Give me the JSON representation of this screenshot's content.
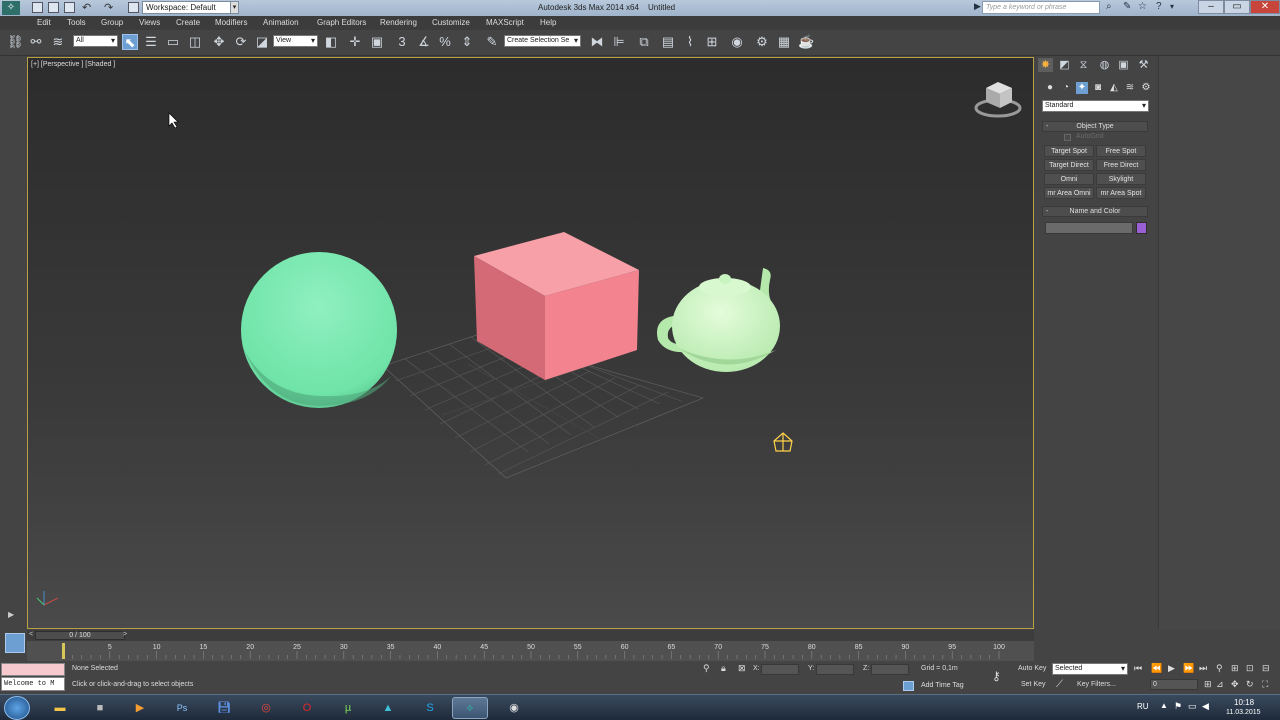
{
  "titlebar": {
    "workspace": "Workspace: Default",
    "app_title": "Autodesk 3ds Max 2014 x64",
    "doc_title": "Untitled",
    "search_placeholder": "Type a keyword or phrase"
  },
  "menu": [
    "Edit",
    "Tools",
    "Group",
    "Views",
    "Create",
    "Modifiers",
    "Animation",
    "Graph Editors",
    "Rendering",
    "Customize",
    "MAXScript",
    "Help"
  ],
  "toolbar": {
    "selection_filter": "All",
    "ref_coord": "View",
    "named_selection": "Create Selection Se"
  },
  "viewport": {
    "label": "[+] [Perspective ] [Shaded ]",
    "border_color": "#b7a143"
  },
  "command_panel": {
    "category_dropdown": "Standard",
    "object_type_header": "Object Type",
    "autogrid_label": "AutoGrid",
    "buttons": [
      "Target Spot",
      "Free Spot",
      "Target Direct",
      "Free Direct",
      "Omni",
      "Skylight",
      "mr Area Omni",
      "mr Area Spot"
    ],
    "name_color_header": "Name and Color",
    "swatch_color": "#9a5fd4"
  },
  "timeline": {
    "frame_display": "0 / 100",
    "ticks": [
      "0",
      "5",
      "10",
      "15",
      "20",
      "25",
      "30",
      "35",
      "40",
      "45",
      "50",
      "55",
      "60",
      "65",
      "70",
      "75",
      "80",
      "85",
      "90",
      "95",
      "100"
    ]
  },
  "status": {
    "listener": "Welcome to M",
    "selected": "None Selected",
    "prompt": "Click or click-and-drag to select objects",
    "x_label": "X:",
    "y_label": "Y:",
    "z_label": "Z:",
    "grid": "Grid = 0,1m",
    "add_time_tag": "Add Time Tag",
    "auto_key": "Auto Key",
    "set_key": "Set Key",
    "selected_dropdown": "Selected",
    "key_filters": "Key Filters...",
    "frame_field": "0"
  },
  "taskbar": {
    "lang": "RU",
    "time": "10:18",
    "date": "11.03.2015"
  },
  "colors": {
    "sphere": "#6fe3a8",
    "box": "#f3848f",
    "teapot": "#c8f4c0",
    "light_icon": "#ffd24a"
  }
}
